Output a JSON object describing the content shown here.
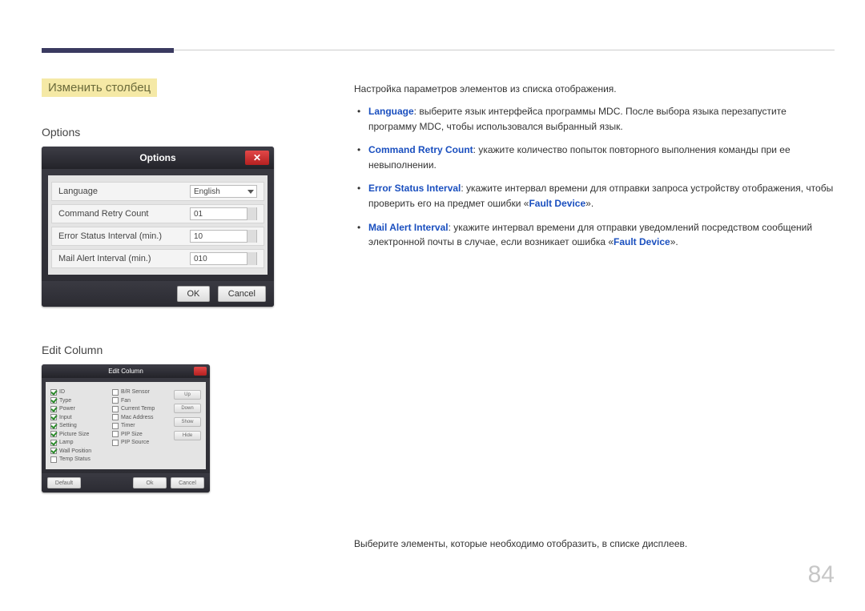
{
  "heading": "Изменить столбец",
  "options": {
    "title": "Options",
    "dialog_title": "Options",
    "rows": {
      "language_label": "Language",
      "language_value": "English",
      "retry_label": "Command Retry Count",
      "retry_value": "01",
      "error_label": "Error Status Interval (min.)",
      "error_value": "10",
      "mail_label": "Mail Alert Interval (min.)",
      "mail_value": "010"
    },
    "ok": "OK",
    "cancel": "Cancel",
    "intro": "Настройка параметров элементов из списка отображения.",
    "bullets": {
      "lang_kw": "Language",
      "lang_txt": ": выберите язык интерфейса программы MDC. После выбора языка перезапустите программу MDC, чтобы использовался выбранный язык.",
      "retry_kw": "Command Retry Count",
      "retry_txt": ": укажите количество попыток повторного выполнения команды при ее невыполнении.",
      "err_kw": "Error Status Interval",
      "err_txt_a": ": укажите интервал времени для отправки запроса устройству отображения, чтобы проверить его на предмет ошибки «",
      "err_fd": "Fault Device",
      "err_txt_b": "».",
      "mail_kw": "Mail Alert Interval",
      "mail_txt_a": ": укажите интервал времени для отправки уведомлений посредством сообщений электронной почты в случае, если возникает ошибка «",
      "mail_fd": "Fault Device",
      "mail_txt_b": "»."
    }
  },
  "editcol": {
    "title": "Edit Column",
    "dialog_title": "Edit Column",
    "desc": "Выберите элементы, которые необходимо отобразить, в списке дисплеев.",
    "col1": [
      {
        "label": "ID",
        "checked": true
      },
      {
        "label": "Type",
        "checked": true
      },
      {
        "label": "Power",
        "checked": true
      },
      {
        "label": "Input",
        "checked": true
      },
      {
        "label": "Setting",
        "checked": true
      },
      {
        "label": "Picture Size",
        "checked": true
      },
      {
        "label": "Lamp",
        "checked": true
      },
      {
        "label": "Wall Position",
        "checked": true
      },
      {
        "label": "Temp Status",
        "checked": false
      }
    ],
    "col2": [
      {
        "label": "B/R Sensor",
        "checked": false
      },
      {
        "label": "Fan",
        "checked": false
      },
      {
        "label": "Current Temp",
        "checked": false
      },
      {
        "label": "Mac Address",
        "checked": false
      },
      {
        "label": "Timer",
        "checked": false
      },
      {
        "label": "PIP Size",
        "checked": false
      },
      {
        "label": "PIP Source",
        "checked": false
      }
    ],
    "side_btns": [
      "Up",
      "Down",
      "Show",
      "Hide"
    ],
    "default": "Default",
    "ok": "Ok",
    "cancel": "Cancel"
  },
  "page_number": "84"
}
